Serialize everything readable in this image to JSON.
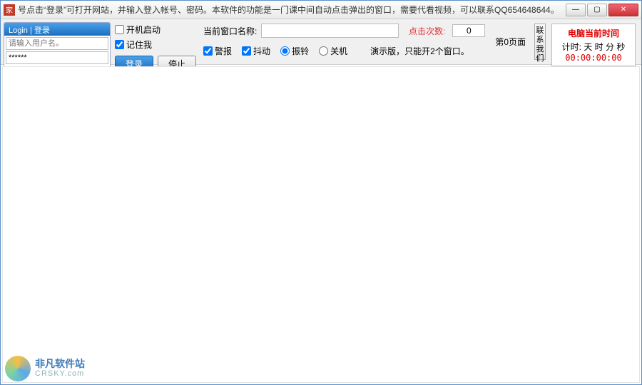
{
  "titlebar": {
    "icon_char": "家",
    "text": "号点击“登录”可打开网站，并输入登入帐号、密码。本软件的功能是一门课中间自动点击弹出的窗口，需要代看视频，可以联系QQ654648644。"
  },
  "login": {
    "header": "Login | 登录",
    "username_placeholder": "请输入用户名。",
    "password_value": "******"
  },
  "options": {
    "startup": "开机启动",
    "startup_checked": false,
    "remember": "记住我",
    "remember_checked": true
  },
  "buttons": {
    "login": "登录",
    "stop": "停止"
  },
  "center": {
    "window_name_label": "当前窗口名称:",
    "window_name_value": "",
    "clicks_label": "点击次数:",
    "clicks_value": "0",
    "alarm": "警报",
    "shake": "抖动",
    "ring": "振铃",
    "shutdown": "关机",
    "demo_text": "演示版，只能开2个窗口。"
  },
  "page_info": "第0页面",
  "contact_btn": "联系我们",
  "clock": {
    "title": "电脑当前时间",
    "labels": "计时: 天 时 分 秒",
    "value": "00:00:00:00"
  },
  "watermark": {
    "cn": "非凡软件站",
    "en": "CRSKY.com"
  }
}
